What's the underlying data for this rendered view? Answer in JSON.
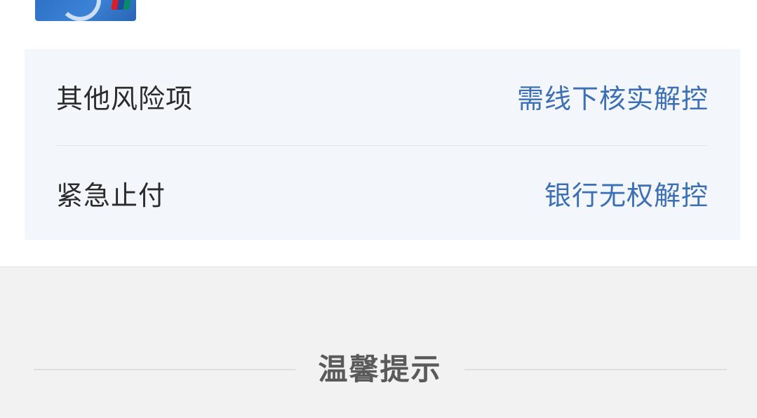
{
  "risk_items": [
    {
      "label": "其他风险项",
      "value": "需线下核实解控"
    },
    {
      "label": "紧急止付",
      "value": "银行无权解控"
    }
  ],
  "tips": {
    "title": "温馨提示"
  },
  "colors": {
    "link_blue": "#3d6fb4",
    "panel_bg": "#f3f7fc",
    "page_bg": "#f2f2f2"
  },
  "icons": {
    "bank_card": "unionpay-card-icon"
  }
}
